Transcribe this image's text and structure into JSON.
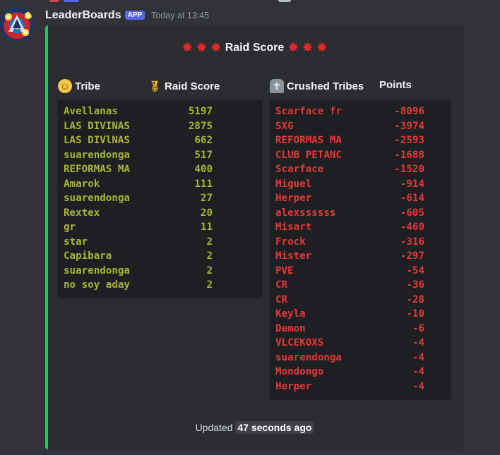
{
  "message": {
    "username": "LeaderBoards",
    "badge": "APP",
    "timestamp": "Today at 13:45"
  },
  "embed": {
    "accent_color": "#22c55e",
    "title": "Raid Score",
    "title_emoji": "collision",
    "fields": {
      "tribe_header": "Tribe",
      "raid_score_header": "Raid Score",
      "crushed_header": "Crushed Tribes",
      "points_header": "Points"
    },
    "raid_rows": [
      {
        "tribe": "Avellanas",
        "score": "5197"
      },
      {
        "tribe": "LAS DIVINAS",
        "score": "2875"
      },
      {
        "tribe": "LAS DIVlNAS",
        "score": "662"
      },
      {
        "tribe": "suarendonga",
        "score": "517"
      },
      {
        "tribe": "REFORMAS MA",
        "score": "400"
      },
      {
        "tribe": "Amarok",
        "score": "111"
      },
      {
        "tribe": "suarendonga",
        "score": "27"
      },
      {
        "tribe": "Rextex",
        "score": "20"
      },
      {
        "tribe": "gr",
        "score": "11"
      },
      {
        "tribe": "star",
        "score": "2"
      },
      {
        "tribe": "Capibara",
        "score": "2"
      },
      {
        "tribe": "suarendonga",
        "score": "2"
      },
      {
        "tribe": "no soy aday",
        "score": "2"
      }
    ],
    "crushed_rows": [
      {
        "tribe": "Scarface fr",
        "points": "-8096"
      },
      {
        "tribe": "SXG",
        "points": "-3974"
      },
      {
        "tribe": "REFORMAS MA",
        "points": "-2593"
      },
      {
        "tribe": "CLUB PETANC",
        "points": "-1688"
      },
      {
        "tribe": "Scarface",
        "points": "-1520"
      },
      {
        "tribe": "Miguel",
        "points": "-914"
      },
      {
        "tribe": "Herper",
        "points": "-614"
      },
      {
        "tribe": "alexssssss",
        "points": "-605"
      },
      {
        "tribe": "Misart",
        "points": "-460"
      },
      {
        "tribe": "Frock",
        "points": "-316"
      },
      {
        "tribe": "Mister",
        "points": "-297"
      },
      {
        "tribe": "PVE",
        "points": "-54"
      },
      {
        "tribe": "CR",
        "points": "-36"
      },
      {
        "tribe": "CR",
        "points": "-28"
      },
      {
        "tribe": "Keyla",
        "points": "-10"
      },
      {
        "tribe": "Demon",
        "points": "-6"
      },
      {
        "tribe": "VLCEKOXS",
        "points": "-4"
      },
      {
        "tribe": "suarendonga",
        "points": "-4"
      },
      {
        "tribe": "Mondongo",
        "points": "-4"
      },
      {
        "tribe": "Herper",
        "points": "-4"
      }
    ],
    "footer": {
      "prefix": "Updated",
      "ago": "47 seconds ago"
    }
  },
  "colors": {
    "raid_text": "#a8b532",
    "crushed_text": "#e23a36",
    "app_badge": "#5865f2"
  }
}
